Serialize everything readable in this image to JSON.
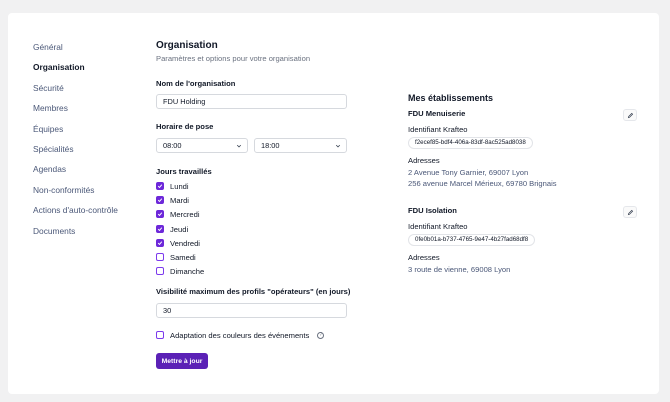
{
  "sidebar": {
    "items": [
      {
        "label": "Général"
      },
      {
        "label": "Organisation"
      },
      {
        "label": "Sécurité"
      },
      {
        "label": "Membres"
      },
      {
        "label": "Équipes"
      },
      {
        "label": "Spécialités"
      },
      {
        "label": "Agendas"
      },
      {
        "label": "Non-conformités"
      },
      {
        "label": "Actions d'auto-contrôle"
      },
      {
        "label": "Documents"
      }
    ],
    "active": "Organisation"
  },
  "main": {
    "title": "Organisation",
    "subtitle": "Paramètres et options pour votre organisation",
    "org_name_label": "Nom de l'organisation",
    "org_name_value": "FDU Holding",
    "schedule_label": "Horaire de pose",
    "start_time": "08:00",
    "end_time": "18:00",
    "workdays_label": "Jours travaillés",
    "days": [
      {
        "label": "Lundi",
        "checked": true
      },
      {
        "label": "Mardi",
        "checked": true
      },
      {
        "label": "Mercredi",
        "checked": true
      },
      {
        "label": "Jeudi",
        "checked": true
      },
      {
        "label": "Vendredi",
        "checked": true
      },
      {
        "label": "Samedi",
        "checked": false
      },
      {
        "label": "Dimanche",
        "checked": false
      }
    ],
    "visibility_label": "Visibilité maximum des profils \"opérateurs\" (en jours)",
    "visibility_value": "30",
    "color_option_label": "Adaptation des couleurs des événements",
    "color_option_checked": false,
    "submit_label": "Mettre à jour"
  },
  "establishments": {
    "title": "Mes établissements",
    "items": [
      {
        "name": "FDU Menuiserie",
        "id_label": "Identifiant Krafteo",
        "id": "f2ecef85-bdf4-406a-83df-8ac525ad8038",
        "addr_label": "Adresses",
        "addresses": [
          "2 Avenue Tony Garnier, 69007 Lyon",
          "256 avenue Marcel Mérieux, 69780 Brignais"
        ]
      },
      {
        "name": "FDU Isolation",
        "id_label": "Identifiant Krafteo",
        "id": "0fe0b01a-b737-4765-9e47-4b27fad68df8",
        "addr_label": "Adresses",
        "addresses": [
          "3 route de vienne, 69008 Lyon"
        ]
      }
    ]
  },
  "colors": {
    "accent": "#5b21b6",
    "checkbox": "#6d28d9"
  }
}
